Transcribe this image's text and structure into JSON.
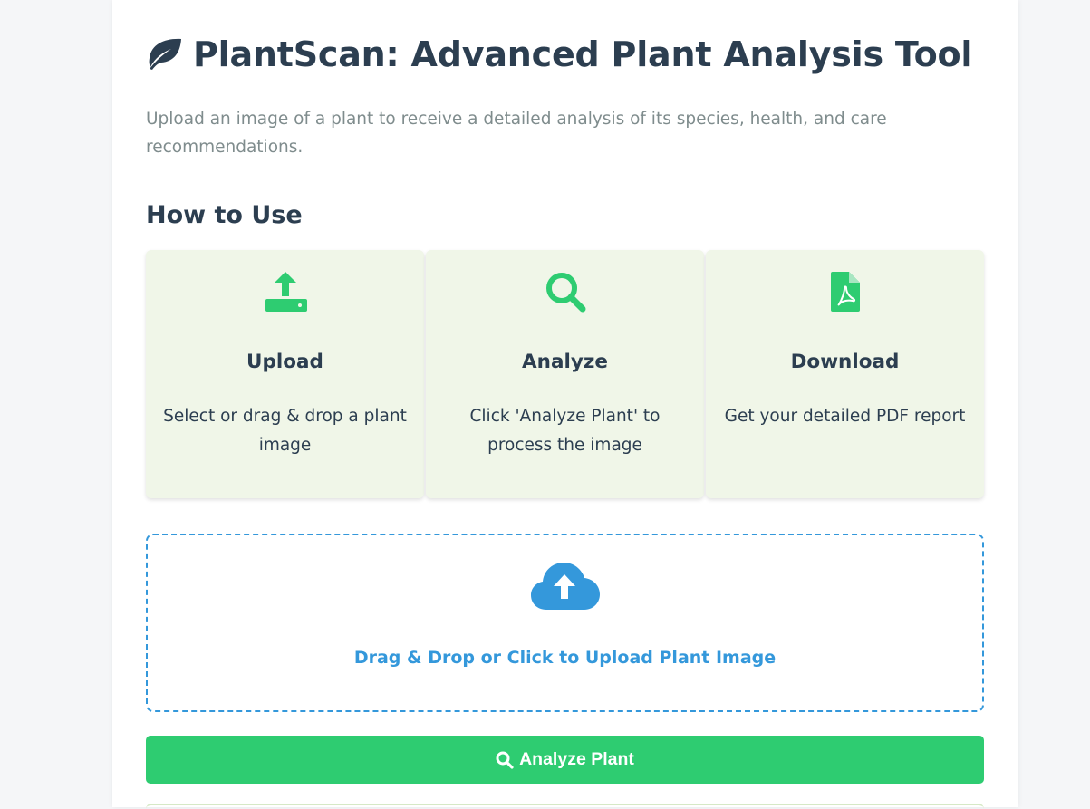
{
  "header": {
    "title": "PlantScan: Advanced Plant Analysis Tool",
    "title_icon": "leaf-icon",
    "subtitle": "Upload an image of a plant to receive a detailed analysis of its species, health, and care recommendations."
  },
  "how_to": {
    "heading": "How to Use",
    "steps": [
      {
        "icon": "upload-icon",
        "name": "Upload",
        "desc": "Select or drag & drop a plant image"
      },
      {
        "icon": "search-icon",
        "name": "Analyze",
        "desc": "Click 'Analyze Plant' to process the image"
      },
      {
        "icon": "pdf-file-icon",
        "name": "Download",
        "desc": "Get your detailed PDF report"
      }
    ]
  },
  "upload": {
    "icon": "cloud-upload-icon",
    "label": "Drag & Drop or Click to Upload Plant Image"
  },
  "analyze_button": {
    "icon": "search-icon",
    "label": "Analyze Plant"
  },
  "colors": {
    "heading": "#2c3e50",
    "muted": "#7f8c8d",
    "green": "#2ecc71",
    "blue": "#3498db",
    "step_bg": "#f0f6e8"
  }
}
